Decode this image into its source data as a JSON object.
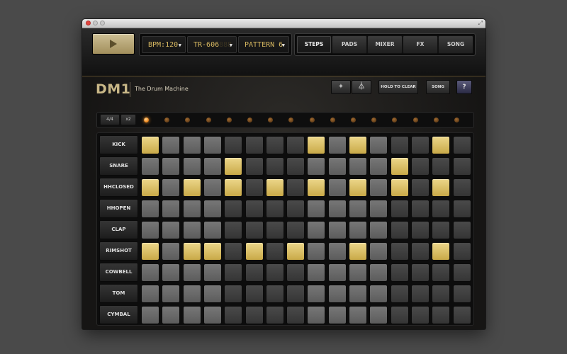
{
  "topbar": {
    "play_icon": "play-icon",
    "bpm": "BPM:120",
    "machine": "TR-606",
    "machine_ghost": "888",
    "pattern": "PATTERN 6",
    "tabs": [
      {
        "label": "STEPS",
        "active": true
      },
      {
        "label": "PADS",
        "active": false
      },
      {
        "label": "MIXER",
        "active": false
      },
      {
        "label": "FX",
        "active": false
      },
      {
        "label": "SONG",
        "active": false
      }
    ]
  },
  "header": {
    "logo": "DM1",
    "subtitle": "The Drum Machine",
    "hold_to_clear": "HOLD TO CLEAR",
    "song": "SONG",
    "help": "?"
  },
  "step_bar": {
    "time_signature": "4/4",
    "multiplier": "x2",
    "current_step": 0,
    "step_count": 16
  },
  "tracks": [
    {
      "name": "KICK",
      "steps": [
        1,
        0,
        0,
        0,
        0,
        0,
        0,
        0,
        1,
        0,
        1,
        0,
        0,
        0,
        1,
        0
      ]
    },
    {
      "name": "SNARE",
      "steps": [
        0,
        0,
        0,
        0,
        1,
        0,
        0,
        0,
        0,
        0,
        0,
        0,
        1,
        0,
        0,
        0
      ]
    },
    {
      "name": "HHCLOSED",
      "steps": [
        1,
        0,
        1,
        0,
        1,
        0,
        1,
        0,
        1,
        0,
        1,
        0,
        1,
        0,
        1,
        0
      ]
    },
    {
      "name": "HHOPEN",
      "steps": [
        0,
        0,
        0,
        0,
        0,
        0,
        0,
        0,
        0,
        0,
        0,
        0,
        0,
        0,
        0,
        0
      ]
    },
    {
      "name": "CLAP",
      "steps": [
        0,
        0,
        0,
        0,
        0,
        0,
        0,
        0,
        0,
        0,
        0,
        0,
        0,
        0,
        0,
        0
      ]
    },
    {
      "name": "RIMSHOT",
      "steps": [
        1,
        0,
        1,
        1,
        0,
        1,
        0,
        1,
        0,
        0,
        1,
        0,
        0,
        0,
        1,
        0
      ]
    },
    {
      "name": "COWBELL",
      "steps": [
        0,
        0,
        0,
        0,
        0,
        0,
        0,
        0,
        0,
        0,
        0,
        0,
        0,
        0,
        0,
        0
      ]
    },
    {
      "name": "TOM",
      "steps": [
        0,
        0,
        0,
        0,
        0,
        0,
        0,
        0,
        0,
        0,
        0,
        0,
        0,
        0,
        0,
        0
      ]
    },
    {
      "name": "CYMBAL",
      "steps": [
        0,
        0,
        0,
        0,
        0,
        0,
        0,
        0,
        0,
        0,
        0,
        0,
        0,
        0,
        0,
        0
      ]
    }
  ],
  "colors": {
    "accent": "#d7b860",
    "pad_on": "#e3c76e",
    "led_on": "#f5962a"
  }
}
